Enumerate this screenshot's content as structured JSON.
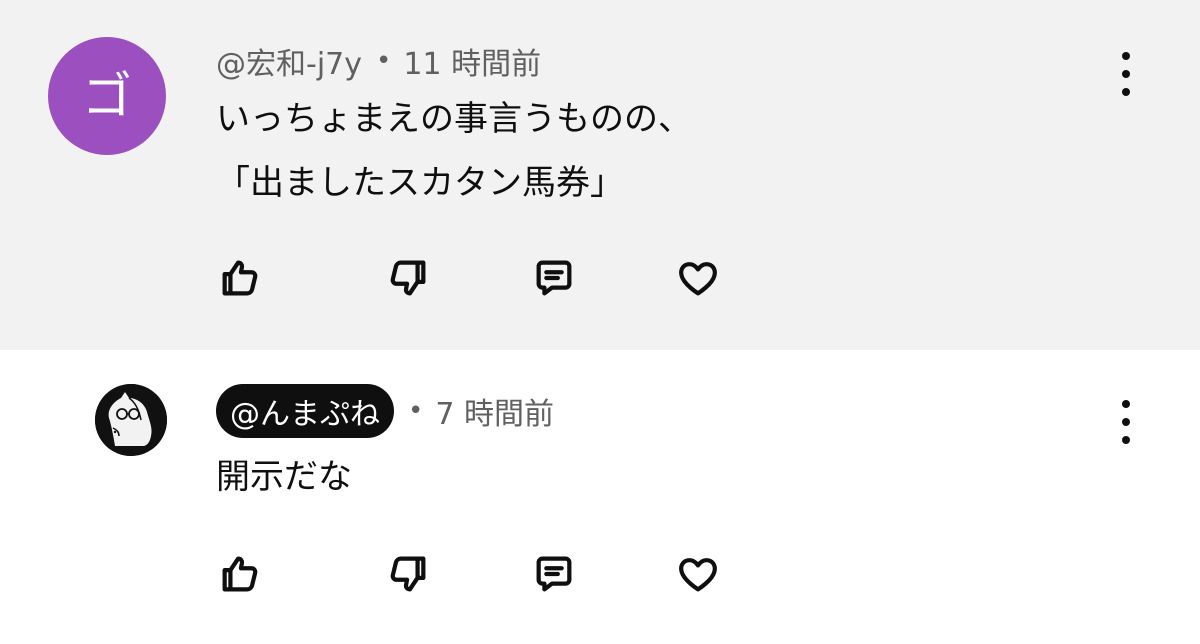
{
  "comments": [
    {
      "author": "@宏和-j7y",
      "separator": "•",
      "time": "11 時間前",
      "avatar_letter": "ゴ",
      "avatar_color": "#9c4fbf",
      "text_line1": "いっちょまえの事言うものの、",
      "text_line2": "「出ましたスカタン馬券」",
      "highlighted": false
    },
    {
      "author": "@んまぷね",
      "separator": "•",
      "time": "7 時間前",
      "avatar_icon": "horse-with-glasses-icon",
      "text_line1": "開示だな",
      "highlighted": true
    }
  ],
  "actions": {
    "like": "thumbs-up-icon",
    "dislike": "thumbs-down-icon",
    "reply": "reply-icon",
    "heart": "heart-icon"
  }
}
